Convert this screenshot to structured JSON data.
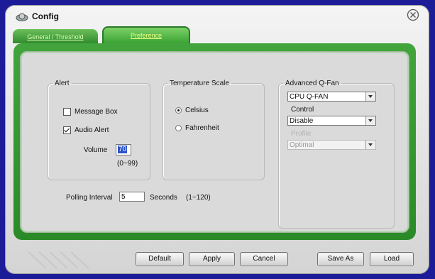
{
  "window": {
    "title": "Config"
  },
  "tabs": [
    {
      "label": "General / Threshold"
    },
    {
      "label": "Preference"
    }
  ],
  "alert": {
    "legend": "Alert",
    "message_box": {
      "label": "Message Box",
      "checked": false
    },
    "audio_alert": {
      "label": "Audio Alert",
      "checked": true
    },
    "volume_label": "Volume",
    "volume_value": "70",
    "volume_range": "(0~99)"
  },
  "temperature": {
    "legend": "Temperature Scale",
    "celsius": {
      "label": "Celsius",
      "selected": true
    },
    "fahrenheit": {
      "label": "Fahrenheit",
      "selected": false
    }
  },
  "qfan": {
    "legend": "Advanced Q-Fan",
    "fan_select": "CPU Q-FAN",
    "control_label": "Control",
    "control_value": "Disable",
    "profile_label": "Profile",
    "profile_value": "Optimal"
  },
  "polling": {
    "label": "Polling Interval",
    "value": "5",
    "unit": "Seconds",
    "range": "(1~120)"
  },
  "buttons": {
    "default": "Default",
    "apply": "Apply",
    "cancel": "Cancel",
    "save_as": "Save As",
    "load": "Load"
  }
}
